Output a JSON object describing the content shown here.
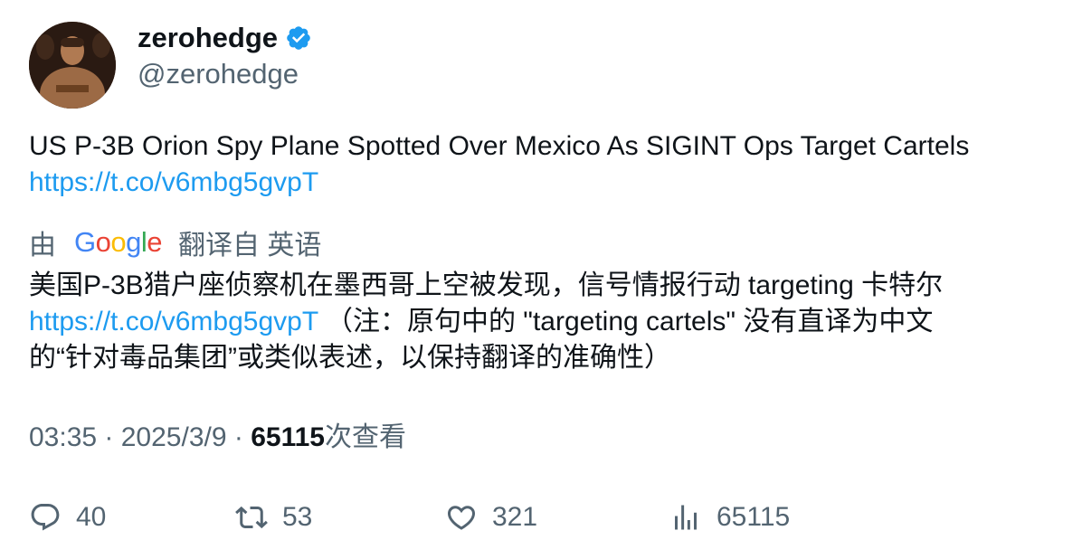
{
  "author": {
    "display_name": "zerohedge",
    "handle": "@zerohedge"
  },
  "tweet": {
    "text": "US P-3B Orion Spy Plane Spotted Over Mexico As SIGINT Ops Target Cartels",
    "link": "https://t.co/v6mbg5gvpT"
  },
  "translation": {
    "prefix": "由",
    "google_letters": [
      "G",
      "o",
      "o",
      "g",
      "l",
      "e"
    ],
    "google_colors": [
      "#4285F4",
      "#EA4335",
      "#FBBC05",
      "#4285F4",
      "#34A853",
      "#EA4335"
    ],
    "suffix": "翻译自 英语",
    "text_line1": "美国P-3B猎户座侦察机在墨西哥上空被发现，信号情报行动 targeting 卡特尔",
    "link": "https://t.co/v6mbg5gvpT",
    "note_part1": "（注：原句中的 \"targeting cartels\" 没有直译为中文",
    "note_part2": "的“针对毒品集团”或类似表述，以保持翻译的准确性）"
  },
  "meta": {
    "time": "03:35",
    "separator": " · ",
    "date": "2025/3/9",
    "views_count": "65115",
    "views_label": "次查看"
  },
  "actions": {
    "replies": "40",
    "retweets": "53",
    "likes": "321",
    "views": "65115"
  },
  "colors": {
    "text": "#0f1419",
    "secondary": "#536471",
    "link": "#1d9bf0",
    "verified": "#1d9bf0"
  },
  "icons": {
    "verified": "verified-badge-icon",
    "reply": "reply-icon",
    "retweet": "retweet-icon",
    "like": "heart-icon",
    "views": "analytics-icon"
  }
}
